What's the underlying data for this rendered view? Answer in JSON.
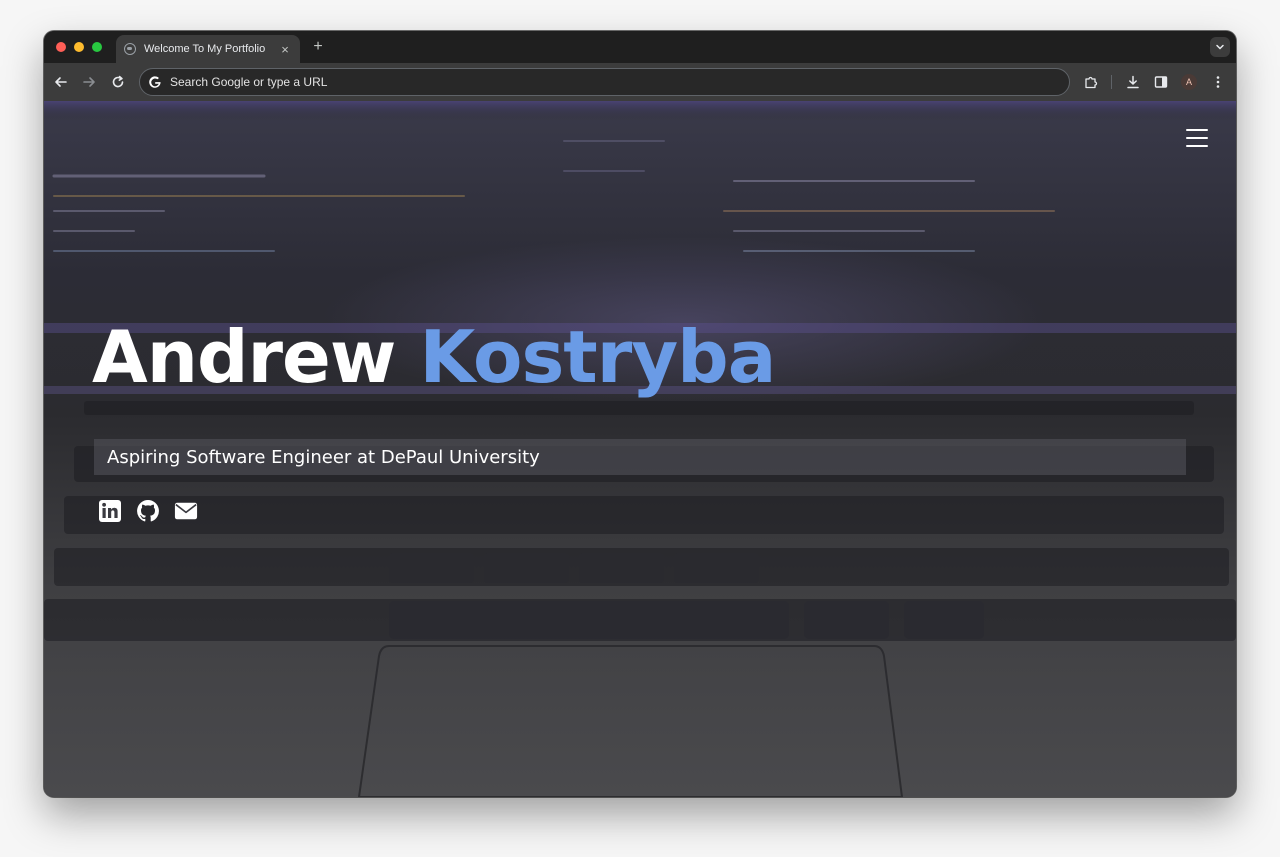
{
  "browser": {
    "tab": {
      "title": "Welcome To My Portfolio",
      "favicon": "globe-icon"
    },
    "new_tab_label": "+",
    "close_label": "×",
    "omnibox": {
      "placeholder": "Search Google or type a URL",
      "value": ""
    },
    "profile_initial": "A",
    "traffic_light_colors": {
      "close": "#ff5f57",
      "minimize": "#febc2e",
      "maximize": "#28c840"
    }
  },
  "page": {
    "hero": {
      "first_name": "Andrew",
      "last_name": "Kostryba",
      "subtitle": "Aspiring Software Engineer at DePaul University"
    },
    "accent_color": "#6a9be6",
    "socials": [
      {
        "name": "linkedin",
        "icon": "linkedin-icon"
      },
      {
        "name": "github",
        "icon": "github-icon"
      },
      {
        "name": "email",
        "icon": "envelope-icon"
      }
    ],
    "menu_icon": "hamburger-menu-icon"
  }
}
